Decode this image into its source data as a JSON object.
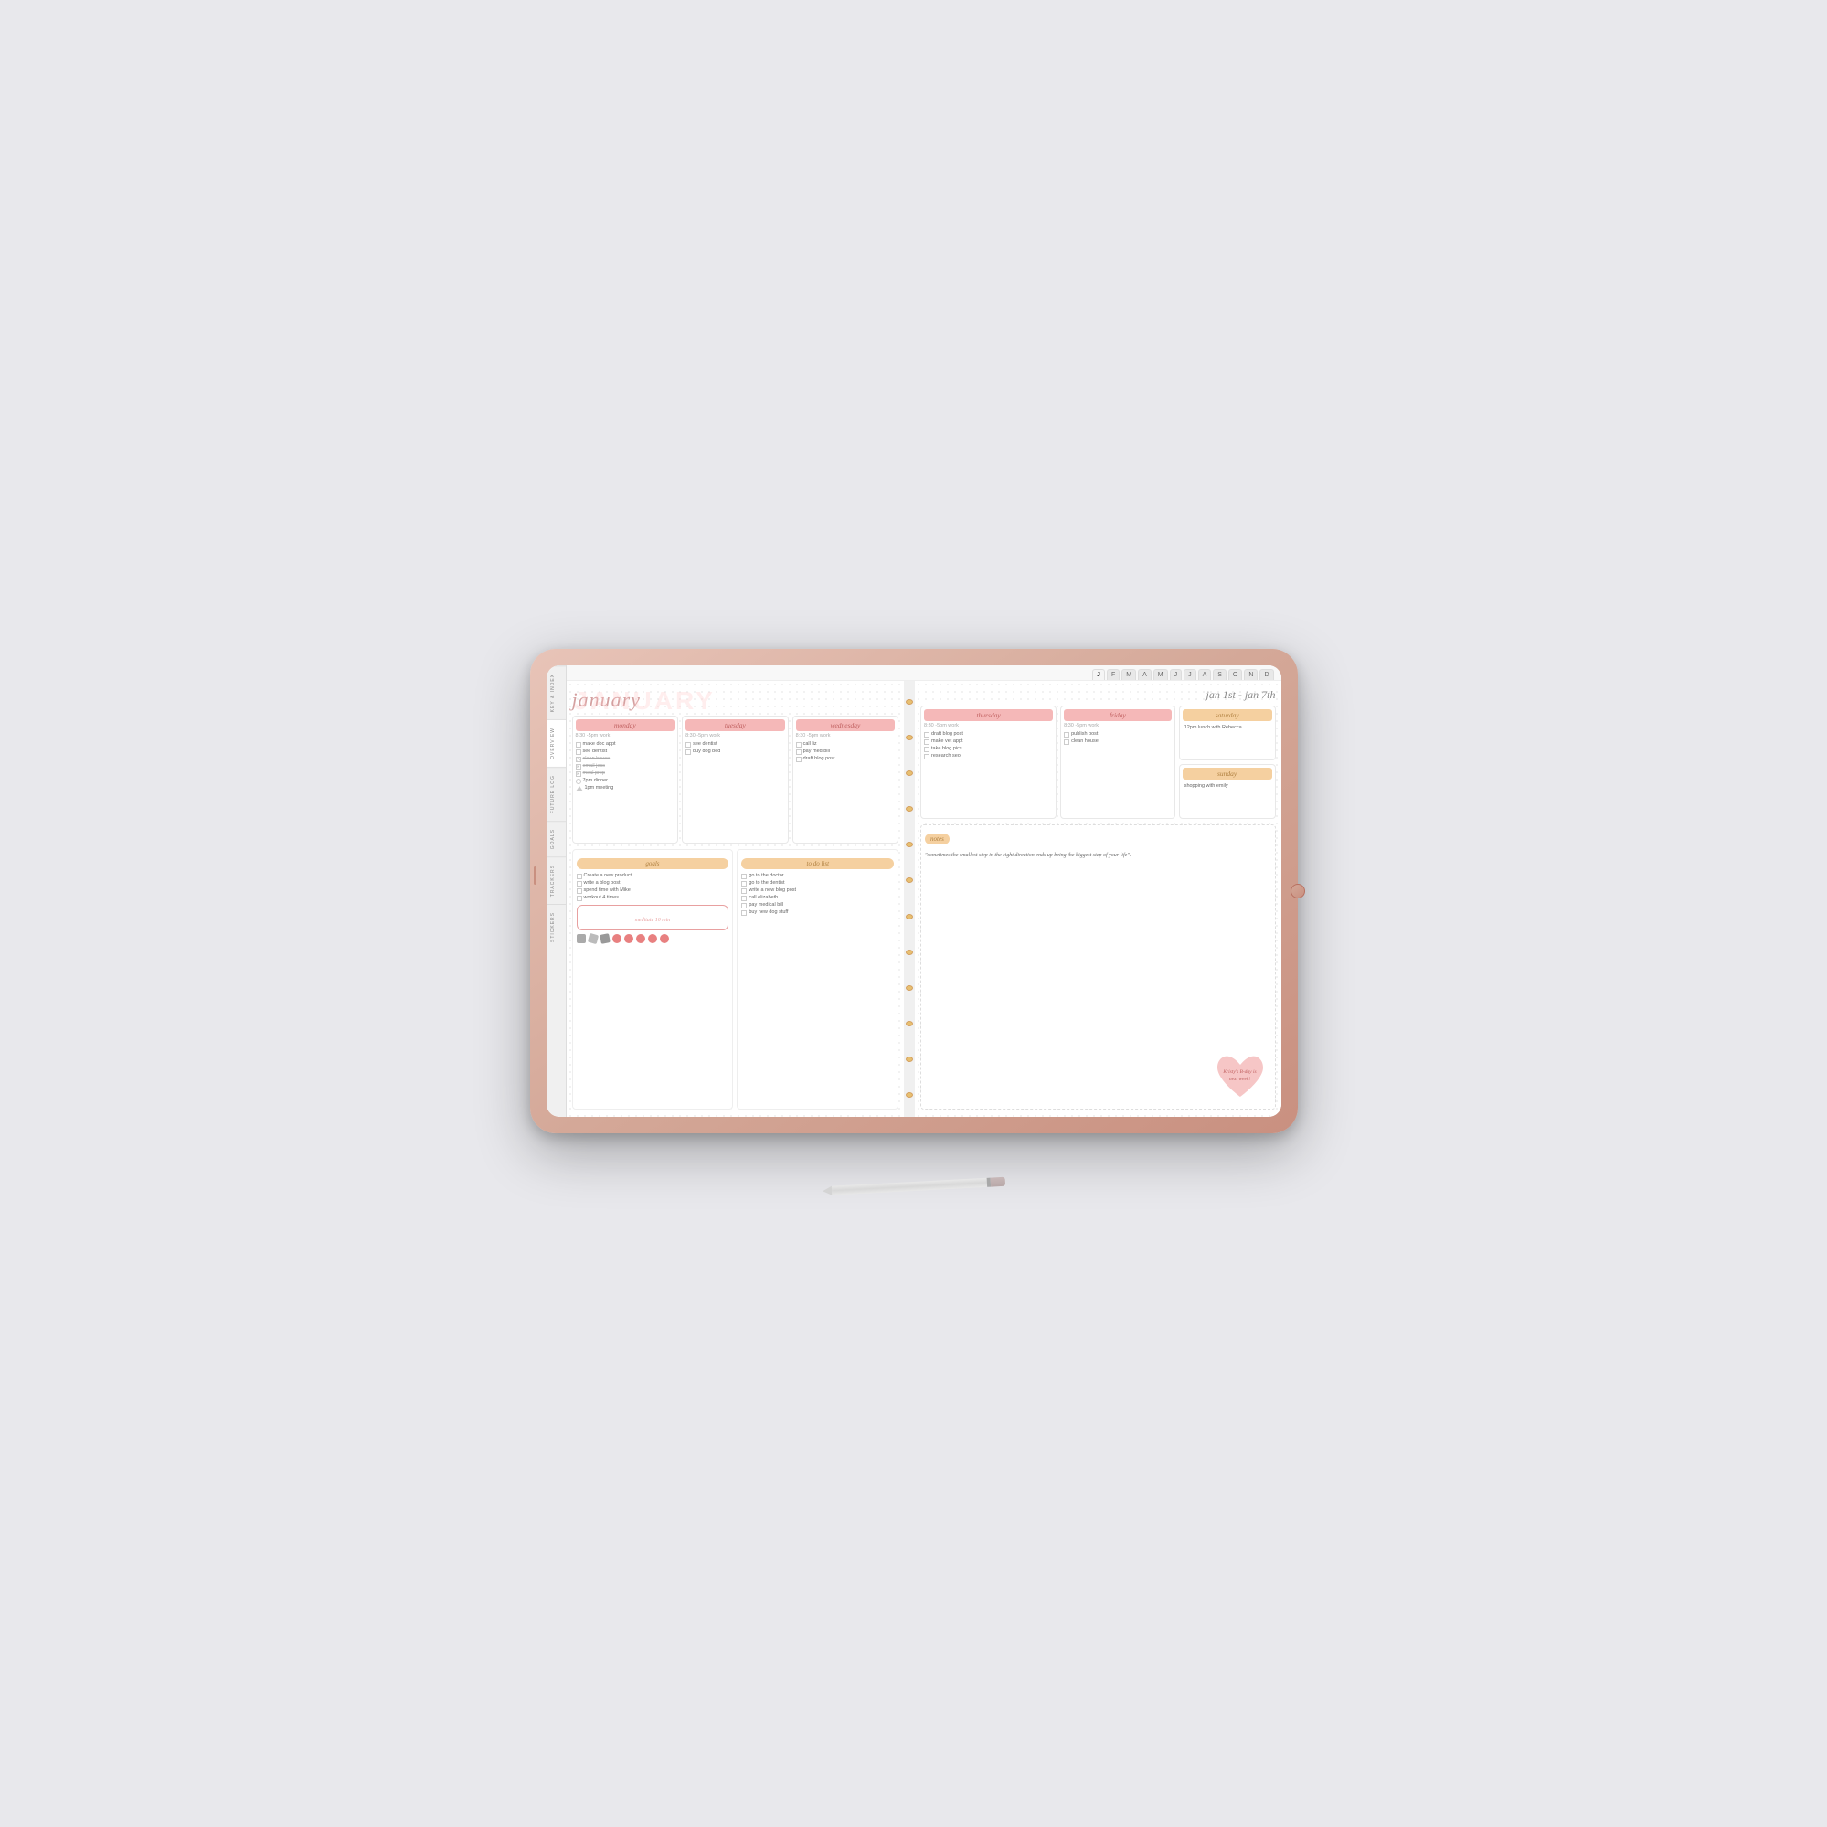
{
  "scene": {
    "background_color": "#e8e8ec"
  },
  "month_tabs": {
    "months": [
      "F",
      "M",
      "A",
      "M",
      "J",
      "J",
      "A",
      "S",
      "O",
      "N",
      "D"
    ],
    "active": "J"
  },
  "sidebar": {
    "tabs": [
      "KEY & INDEX",
      "OVERVIEW",
      "FUTURE LOG",
      "GOALS",
      "TRACKERS",
      "STICKERS"
    ]
  },
  "left_page": {
    "month": "january",
    "bg_text": "JANUARY",
    "days": [
      {
        "name": "monday",
        "style": "pink",
        "time": "8:30 -5pm work",
        "tasks": [
          {
            "type": "checkbox",
            "text": "make doc appt",
            "done": false
          },
          {
            "type": "checkbox",
            "text": "see dentist",
            "done": false
          },
          {
            "type": "strikethrough",
            "text": "clean house",
            "done": true
          },
          {
            "type": "x",
            "text": "email jess",
            "done": true
          },
          {
            "type": "x",
            "text": "meal prep",
            "done": true
          },
          {
            "type": "circle",
            "text": "7pm dinner",
            "done": false
          },
          {
            "type": "triangle",
            "text": "1pm meeting",
            "done": false
          }
        ]
      },
      {
        "name": "tuesday",
        "style": "pink",
        "time": "8:30 -5pm work",
        "tasks": [
          {
            "type": "checkbox",
            "text": "see dentist",
            "done": false
          },
          {
            "type": "checkbox",
            "text": "buy dog bed",
            "done": false
          }
        ]
      },
      {
        "name": "wednesday",
        "style": "pink",
        "time": "8:30 -5pm work",
        "tasks": [
          {
            "type": "checkbox",
            "text": "call liz",
            "done": false
          },
          {
            "type": "checkbox",
            "text": "pay med bill",
            "done": false
          },
          {
            "type": "checkbox",
            "text": "draft blog post",
            "done": false
          }
        ]
      }
    ],
    "goals": {
      "header": "goals",
      "items": [
        "Create a new product",
        "write a blog post",
        "spend time with Mike",
        "workout 4 times"
      ],
      "highlight": "meditate 10 min"
    },
    "todo": {
      "header": "to do list",
      "items": [
        "go to the doctor",
        "go to the dentist",
        "write a new blog post",
        "call elizabeth",
        "pay medical bill",
        "buy new dog stuff"
      ]
    }
  },
  "right_page": {
    "week_header": "jan 1st - jan 7th",
    "days": [
      {
        "name": "thursday",
        "style": "pink",
        "time": "8:30 -5pm work",
        "tasks": [
          {
            "type": "checkbox",
            "text": "draft blog post",
            "done": false
          },
          {
            "type": "checkbox",
            "text": "make vet appt",
            "done": false
          },
          {
            "type": "checkbox",
            "text": "take blog pics",
            "done": false
          },
          {
            "type": "checkbox",
            "text": "research seo",
            "done": false
          }
        ]
      },
      {
        "name": "friday",
        "style": "pink",
        "time": "8:30 -5pm work",
        "tasks": [
          {
            "type": "checkbox",
            "text": "publish post",
            "done": false
          },
          {
            "type": "checkbox",
            "text": "clean house",
            "done": false
          }
        ]
      },
      {
        "name": "saturday",
        "style": "peach",
        "note": "12pm lunch with Rebecca",
        "tasks": []
      },
      {
        "name": "sunday",
        "style": "peach",
        "note": "shopping with emily",
        "tasks": []
      }
    ],
    "notes": {
      "header": "notes",
      "quote": "\"sometimes the smallest step in the right direction ends up being the biggest step of your life\".",
      "sticky": "Kristy's B-day is next week!"
    }
  }
}
